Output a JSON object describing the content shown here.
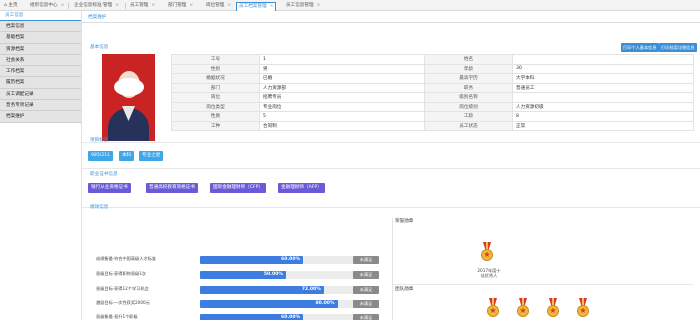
{
  "tabs": [
    {
      "label": "主页",
      "active": false,
      "closable": false
    },
    {
      "label": "组织信息中心",
      "active": false,
      "closable": true
    },
    {
      "label": "企业信息标准·管理",
      "active": false,
      "closable": true
    },
    {
      "label": "员工管理",
      "active": false,
      "closable": true
    },
    {
      "label": "部门管理",
      "active": false,
      "closable": true
    },
    {
      "label": "岗位管理",
      "active": false,
      "closable": true
    },
    {
      "label": "员工档案管理",
      "active": true,
      "closable": true
    },
    {
      "label": "员工信息管理",
      "active": false,
      "closable": true
    }
  ],
  "sidebar": {
    "title": "员工信息",
    "items": [
      "档案信息",
      "基础档案",
      "资源档案",
      "社会关系",
      "工作档案",
      "履历档案",
      "员工调配记录",
      "晋务专项记录",
      "档案维护"
    ]
  },
  "breadcrumb": "档案维护",
  "basic": {
    "section_title": "基本信息",
    "btn_print_basic": "打印个人基本信息",
    "btn_print_detail": "打印档案详细信息",
    "rows": [
      [
        "工号",
        "1",
        "姓名",
        ""
      ],
      [
        "性别",
        "男",
        "年龄",
        "30"
      ],
      [
        "婚姻状况",
        "已婚",
        "最高学历",
        "大学本科"
      ],
      [
        "部门",
        "人力资源部",
        "职务",
        "普通员工"
      ],
      [
        "岗位",
        "招聘专员",
        "级别名称",
        ""
      ],
      [
        "岗位类型",
        "专业岗位",
        "岗位级别",
        "人力资源初级"
      ],
      [
        "性质",
        "5",
        "工龄",
        "8"
      ],
      [
        "工种",
        "合同制",
        "员工状态",
        "正常"
      ]
    ]
  },
  "project_tags": {
    "title": "项目标签",
    "items": [
      "985/211",
      "本科",
      "专业之星"
    ]
  },
  "cert_tags": {
    "title": "职业证书信息",
    "items": [
      "银行从业资格证书",
      "普通高校教育资格证书",
      "国际金融理财师（CFP）",
      "金融理财师（AFP）"
    ]
  },
  "goals": {
    "title": "绩效信息",
    "items": [
      {
        "label": "成绩衡量·符合中国高级人才标准",
        "percent": 60,
        "pct_text": "60.00%",
        "status": "未满足"
      },
      {
        "label": "晋级目标·获得职称晋级1次",
        "percent": 50,
        "pct_text": "50.00%",
        "status": "未满足"
      },
      {
        "label": "晋级目标·获得12个学习机会",
        "percent": 72,
        "pct_text": "72.00%",
        "status": "未满足"
      },
      {
        "label": "激励目标·一次性获奖2000元",
        "percent": 80,
        "pct_text": "80.00%",
        "status": "未满足"
      },
      {
        "label": "晋级衡量·晋升1个职级",
        "percent": 60,
        "pct_text": "60.00%",
        "status": "未满足"
      }
    ]
  },
  "medals": {
    "title": "荣誉勋章",
    "featured_caption_1": "2017年度十",
    "featured_caption_2": "佳优秀人",
    "team_title": "团队勋章",
    "team_count": 4
  },
  "colors": {
    "accent": "#3b8fd6",
    "progress": "#3d7ce0",
    "tag_blue": "#3fa6e8",
    "tag_purple": "#6a5ad8",
    "status_grey": "#8a8a8a",
    "photo_bg": "#c92323"
  }
}
